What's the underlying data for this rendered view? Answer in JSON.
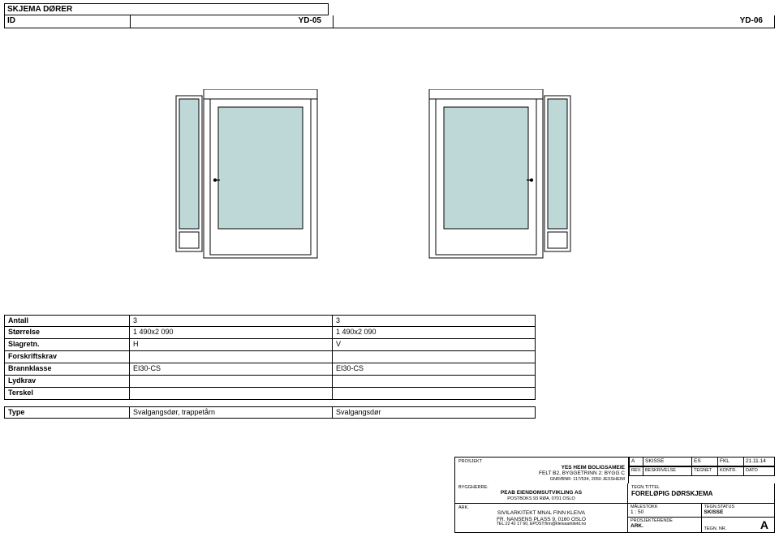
{
  "header": {
    "schema_title": "SKJEMA DØRER",
    "id_label": "ID",
    "col1_id": "YD-05",
    "col2_id": "YD-06"
  },
  "schedule": {
    "rows": [
      {
        "label": "Antall",
        "c1": "3",
        "c2": "3"
      },
      {
        "label": "Størrelse",
        "c1": "1 490x2 090",
        "c2": "1 490x2 090"
      },
      {
        "label": "Slagretn.",
        "c1": "H",
        "c2": "V"
      },
      {
        "label": "Forskriftskrav",
        "c1": "",
        "c2": ""
      },
      {
        "label": "Brannklasse",
        "c1": "EI30-CS",
        "c2": "EI30-CS"
      },
      {
        "label": "Lydkrav",
        "c1": "",
        "c2": ""
      },
      {
        "label": "Terskel",
        "c1": "",
        "c2": ""
      }
    ],
    "type_label": "Type",
    "type_c1": "Svalgangsdør, trappetårn",
    "type_c2": "Svalgangsdør"
  },
  "titleblock": {
    "prosjekt_label": "PROSJEKT",
    "prosjekt_line1": "YES HEIM BOLIGSAMEIE",
    "prosjekt_line2": "FELT B2, BYGGETRINN 2: BYGG C",
    "prosjekt_line3": "GNR/BNR: 117/534, 2050 JESSHEIM",
    "rev_rows": [
      {
        "rev": "A",
        "besk": "SKISSE",
        "tegn": "ES",
        "kontr": "FKL",
        "dato": "21.11.14"
      }
    ],
    "rev_headers": {
      "rev": "REV.",
      "besk": "BESKRIVELSE",
      "tegn": "TEGNET",
      "kontr": "KONTR.",
      "dato": "DATO"
    },
    "byggherre_label": "BYGGHERRE:",
    "byggherre_name": "PEAB EIENDOMSUTVIKLING AS",
    "byggherre_addr": "POSTBOKS 93 RØA, 0701 OSLO",
    "tegntittel_label": "TEGN.TITTEL",
    "tegntittel_value": "FORELØPIG DØRSKJEMA",
    "ark_label": "ARK.",
    "ark_name": "SIVILARKITEKT MNAL FINN KLEIVA",
    "ark_addr": "FR. NANSENS PLASS 9, 0160 OSLO",
    "ark_contact": "TEL:22 42 17 60, EPOST:finn@kleivaarkitekt.no",
    "malestokk_label": "MÅLESTOKK",
    "malestokk_value": "1 : 50",
    "status_label": "TEGN.STATUS",
    "status_value": "SKISSE",
    "prosj_label": "PROSJEKTERENDE",
    "prosj_value": "ARK.",
    "tegnnr_label": "TEGN. NR.",
    "tegnnr_value": "A"
  },
  "icons": {
    "door_panel_fill": "#bed7d7"
  }
}
